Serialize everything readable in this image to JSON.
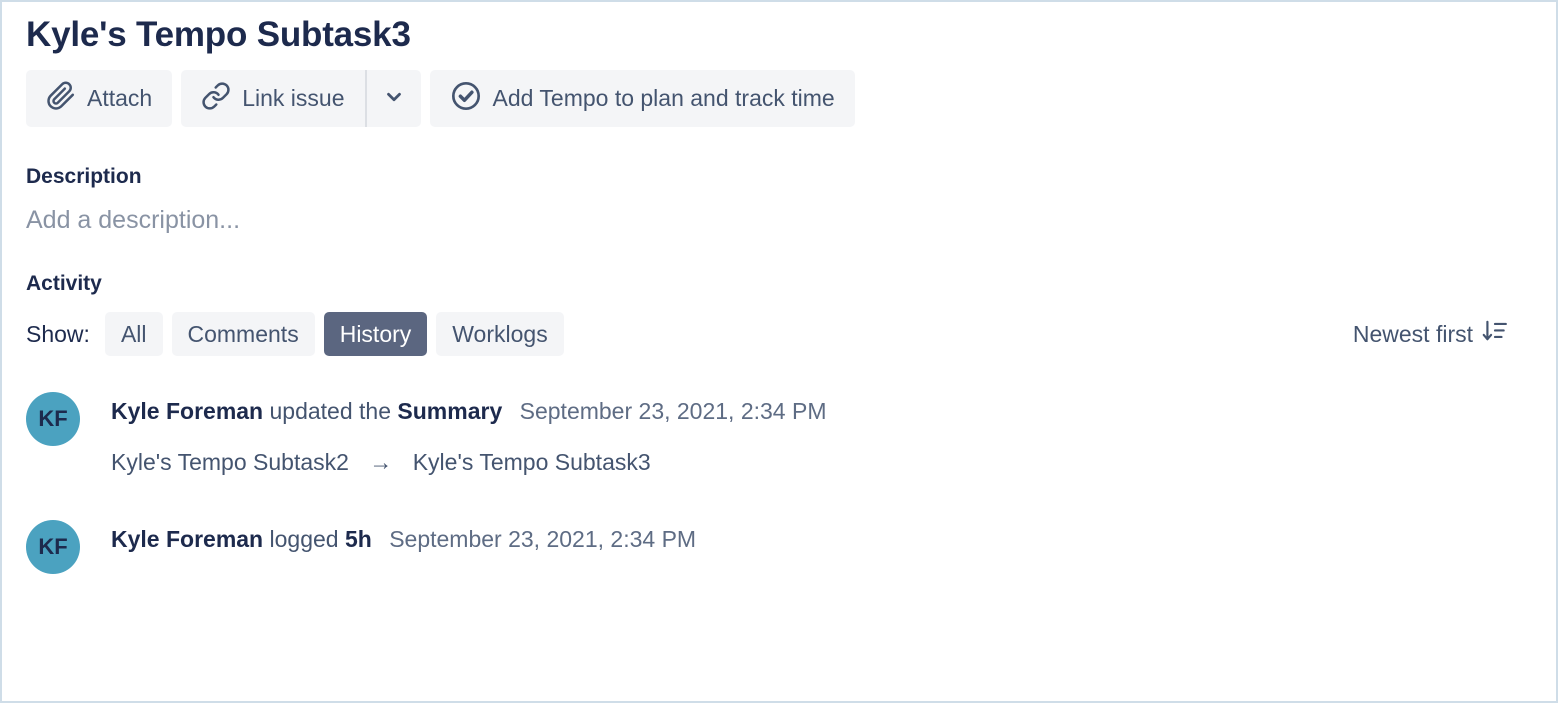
{
  "issue": {
    "title": "Kyle's Tempo Subtask3"
  },
  "toolbar": {
    "attach_label": "Attach",
    "attach_icon": "paperclip-icon",
    "link_issue_label": "Link issue",
    "link_issue_icon": "chain-link-icon",
    "more_icon": "chevron-down-icon",
    "tempo_label": "Add Tempo to plan and track time",
    "tempo_icon": "check-circle-icon"
  },
  "description": {
    "heading": "Description",
    "placeholder": "Add a description..."
  },
  "activity": {
    "heading": "Activity",
    "show_label": "Show:",
    "filters": [
      {
        "label": "All",
        "active": false
      },
      {
        "label": "Comments",
        "active": false
      },
      {
        "label": "History",
        "active": true
      },
      {
        "label": "Worklogs",
        "active": false
      }
    ],
    "sort": {
      "label": "Newest first",
      "icon": "sort-descending-icon"
    },
    "items": [
      {
        "avatar_initials": "KF",
        "author": "Kyle Foreman",
        "action": "updated the",
        "field": "Summary",
        "timestamp": "September 23, 2021, 2:34 PM",
        "change_from": "Kyle's Tempo Subtask2",
        "change_arrow": "→",
        "change_to": "Kyle's Tempo Subtask3"
      },
      {
        "avatar_initials": "KF",
        "author": "Kyle Foreman",
        "action": "logged",
        "field": "5h",
        "timestamp": "September 23, 2021, 2:34 PM",
        "change_from": "",
        "change_arrow": "",
        "change_to": ""
      }
    ]
  },
  "colors": {
    "title_text": "#1d2a4d",
    "body_text": "#44546f",
    "muted_text": "#5e6c84",
    "placeholder_text": "#8993a4",
    "pill_bg": "#f4f5f7",
    "pill_active_bg": "#5b6680",
    "avatar_bg": "#4ba2c0",
    "page_border": "#cfdde8"
  }
}
